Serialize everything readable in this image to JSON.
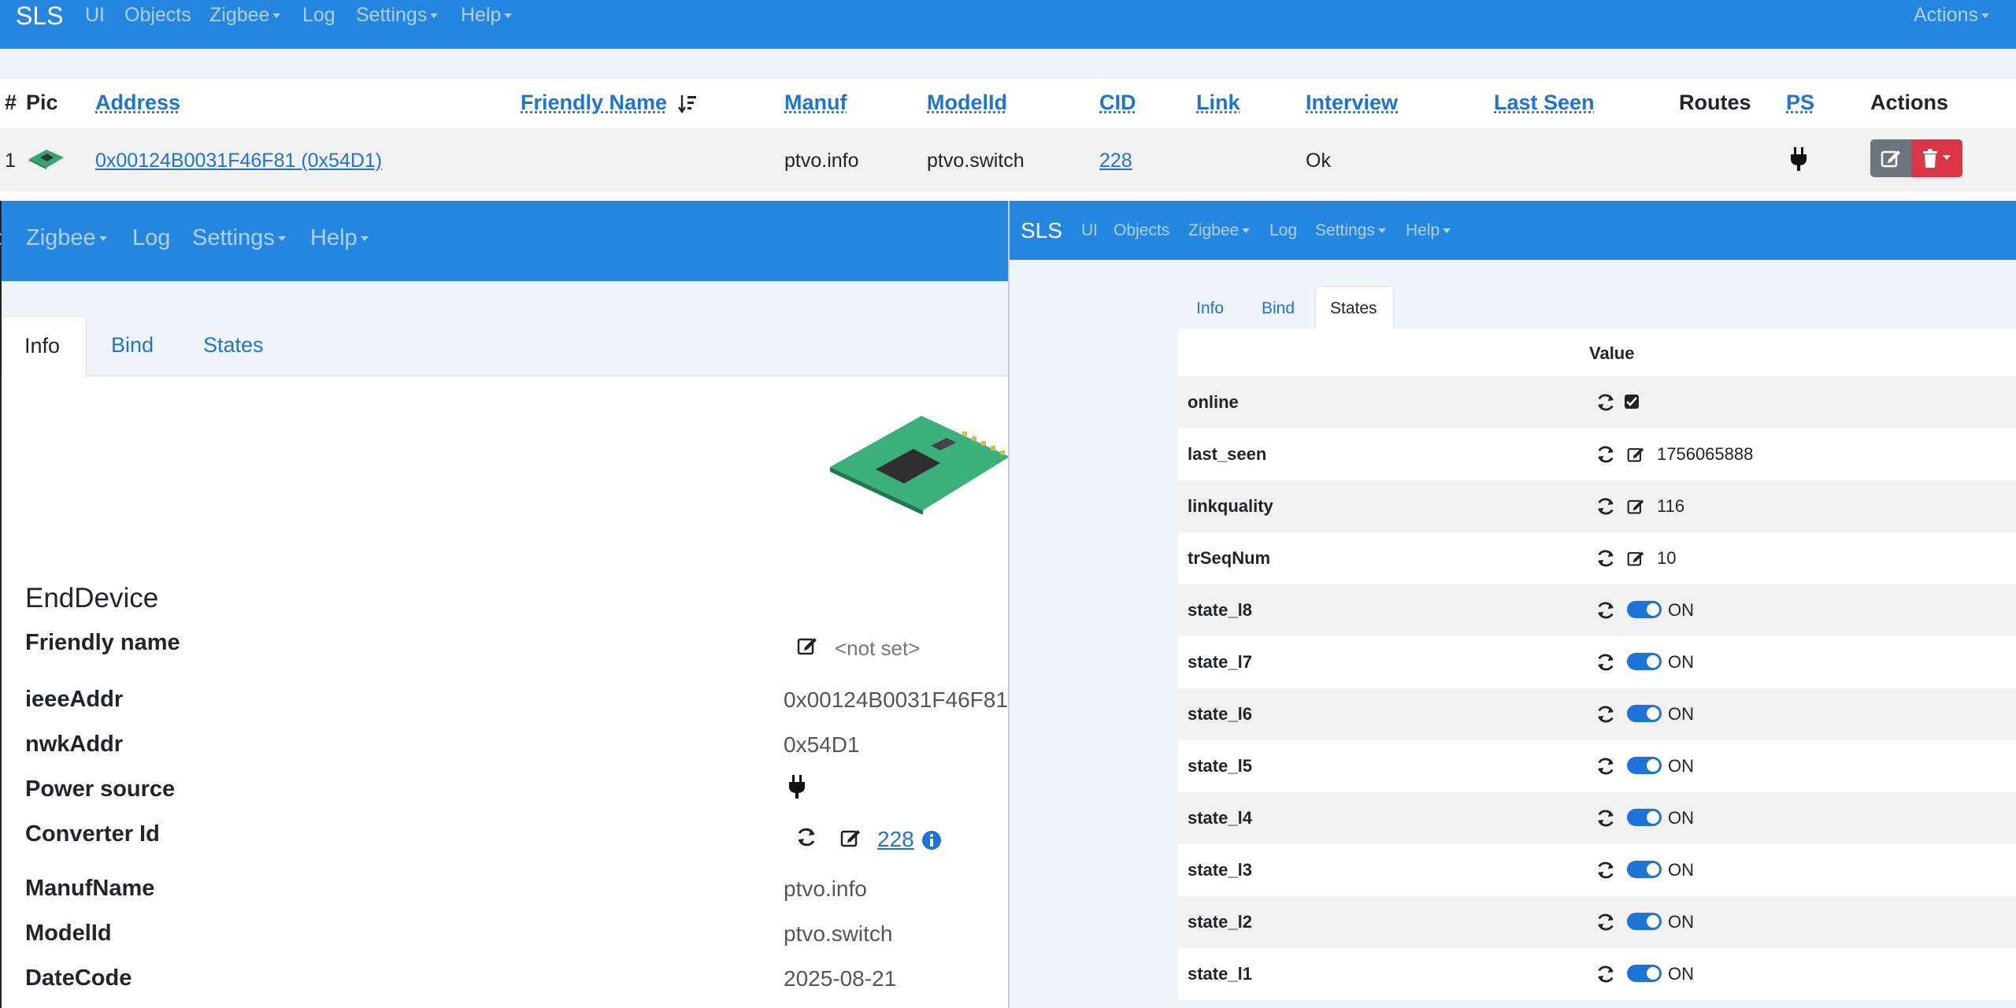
{
  "colors": {
    "navbar": "#2586e0",
    "link": "#1e73d6",
    "danger": "#dc3545",
    "secondary": "#6c757d"
  },
  "nav": {
    "brand": "SLS",
    "items": [
      "UI",
      "Objects",
      "Zigbee",
      "Log",
      "Settings",
      "Help"
    ],
    "actions": "Actions"
  },
  "device_table": {
    "headers": {
      "num": "#",
      "pic": "Pic",
      "address": "Address",
      "friendly_name": "Friendly Name",
      "manuf": "Manuf",
      "model": "ModelId",
      "cid": "CID",
      "link": "Link",
      "interview": "Interview",
      "last_seen": "Last Seen",
      "routes": "Routes",
      "ps": "PS",
      "actions": "Actions"
    },
    "rows": [
      {
        "num": "1",
        "address": "0x00124B0031F46F81 (0x54D1)",
        "friendly_name": "",
        "manuf": "ptvo.info",
        "model": "ptvo.switch",
        "cid": "228",
        "link": "",
        "interview": "Ok",
        "last_seen": "",
        "routes": "",
        "ps_icon": "plug-icon"
      }
    ]
  },
  "left": {
    "tabs": [
      "Info",
      "Bind",
      "States"
    ],
    "active_tab": "Info",
    "device_type": "EndDevice",
    "fields": {
      "friendly_name": {
        "label": "Friendly name",
        "value": "<not set>"
      },
      "ieee": {
        "label": "ieeeAddr",
        "value": "0x00124B0031F46F81"
      },
      "nwk": {
        "label": "nwkAddr",
        "value": "0x54D1"
      },
      "power": {
        "label": "Power source",
        "icon": "plug-icon"
      },
      "cid": {
        "label": "Converter Id",
        "value": "228"
      },
      "manuf": {
        "label": "ManufName",
        "value": "ptvo.info"
      },
      "model": {
        "label": "ModelId",
        "value": "ptvo.switch"
      },
      "date": {
        "label": "DateCode",
        "value": "2025-08-21"
      }
    }
  },
  "right": {
    "tabs": [
      "Info",
      "Bind",
      "States"
    ],
    "active_tab": "States",
    "value_header": "Value",
    "states": [
      {
        "name": "online",
        "type": "checkbox",
        "checked": true
      },
      {
        "name": "last_seen",
        "type": "edit",
        "value": "1756065888"
      },
      {
        "name": "linkquality",
        "type": "edit",
        "value": "116"
      },
      {
        "name": "trSeqNum",
        "type": "edit",
        "value": "10"
      },
      {
        "name": "state_l8",
        "type": "toggle",
        "value": "ON"
      },
      {
        "name": "state_l7",
        "type": "toggle",
        "value": "ON"
      },
      {
        "name": "state_l6",
        "type": "toggle",
        "value": "ON"
      },
      {
        "name": "state_l5",
        "type": "toggle",
        "value": "ON"
      },
      {
        "name": "state_l4",
        "type": "toggle",
        "value": "ON"
      },
      {
        "name": "state_l3",
        "type": "toggle",
        "value": "ON"
      },
      {
        "name": "state_l2",
        "type": "toggle",
        "value": "ON"
      },
      {
        "name": "state_l1",
        "type": "toggle",
        "value": "ON"
      }
    ]
  }
}
